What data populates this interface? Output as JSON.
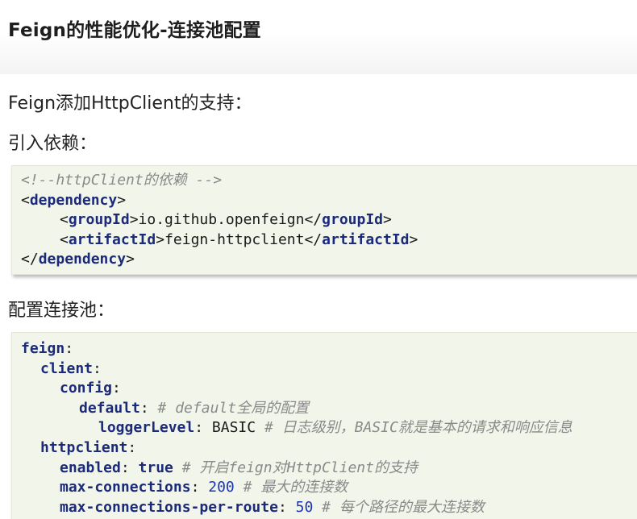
{
  "title": "Feign的性能优化-连接池配置",
  "intro": "Feign添加HttpClient的支持：",
  "step1": "引入依赖：",
  "step2": "配置连接池：",
  "xml": {
    "comment": "<!--httpClient的依赖 -->",
    "dep_open_lt": "<",
    "dep_name": "dependency",
    "dep_open_gt": ">",
    "group_open_lt": "<",
    "group_name": "groupId",
    "group_open_gt": ">",
    "group_value": "io.github.openfeign",
    "group_close_lt": "</",
    "group_close_gt": ">",
    "artifact_open_lt": "<",
    "artifact_name": "artifactId",
    "artifact_open_gt": ">",
    "artifact_value": "feign-httpclient",
    "artifact_close_lt": "</",
    "artifact_close_gt": ">",
    "dep_close_lt": "</",
    "dep_close_gt": ">"
  },
  "yaml": {
    "feign_key": "feign",
    "colon": ":",
    "client_key": "client",
    "config_key": "config",
    "default_key": "default",
    "default_comment": "# default全局的配置",
    "loggerLevel_key": "loggerLevel",
    "loggerLevel_value": "BASIC",
    "loggerLevel_comment": "# 日志级别，BASIC就是基本的请求和响应信息",
    "httpclient_key": "httpclient",
    "enabled_key": "enabled",
    "enabled_value": "true",
    "enabled_comment": "# 开启feign对HttpClient的支持",
    "maxconn_key": "max-connections",
    "maxconn_value": "200",
    "maxconn_comment": "# 最大的连接数",
    "maxroute_key": "max-connections-per-route",
    "maxroute_value": "50",
    "maxroute_comment": "# 每个路径的最大连接数"
  }
}
